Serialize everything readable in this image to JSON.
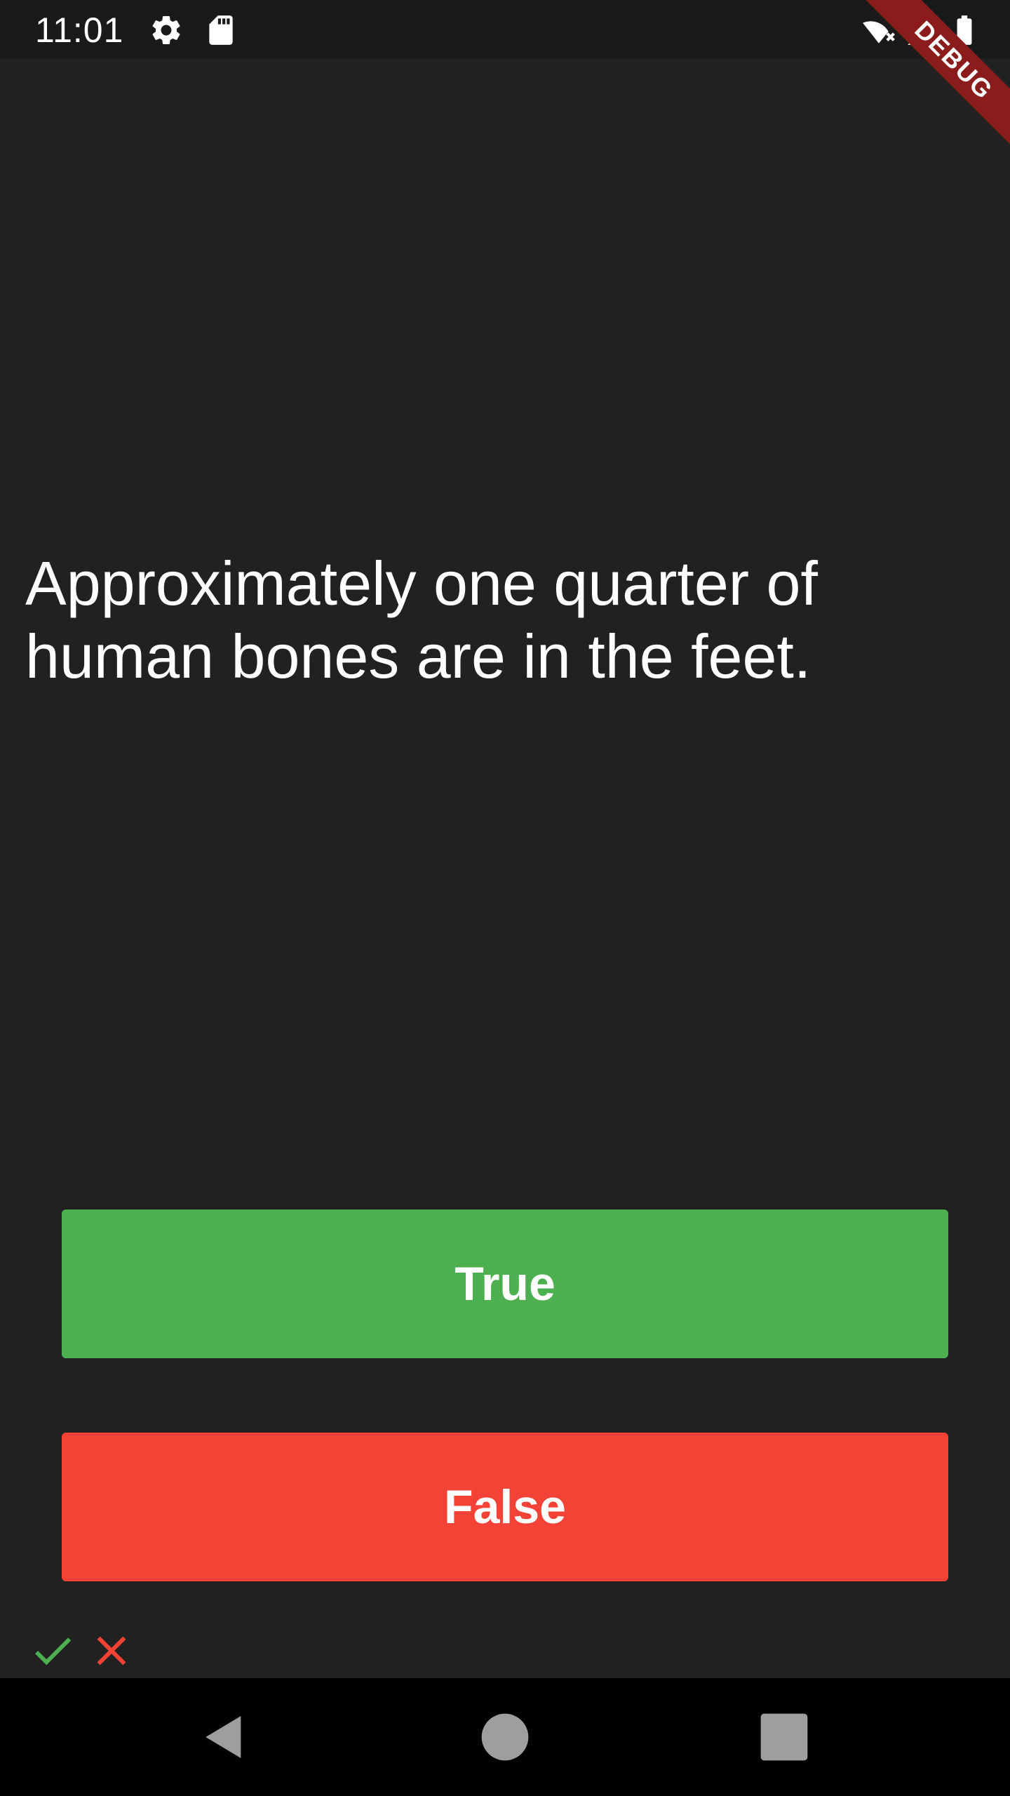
{
  "status_bar": {
    "time": "11:01",
    "icons": [
      "gear-icon",
      "sd-card-icon",
      "wifi-off-icon",
      "cell-signal-icon",
      "battery-icon"
    ]
  },
  "debug_banner": "DEBUG",
  "question": {
    "text": "Approximately one quarter of human bones are in the feet."
  },
  "answers": {
    "true_label": "True",
    "false_label": "False"
  },
  "score": [
    "check-icon",
    "close-icon"
  ],
  "nav_bar": {
    "icons": [
      "back-icon",
      "home-icon",
      "recents-icon"
    ]
  },
  "colors": {
    "background": "#212121",
    "true_button": "#4CAF50",
    "false_button": "#F44336",
    "correct": "#4CAF50",
    "wrong": "#F44336",
    "debug_ribbon": "#8B1C1C"
  }
}
